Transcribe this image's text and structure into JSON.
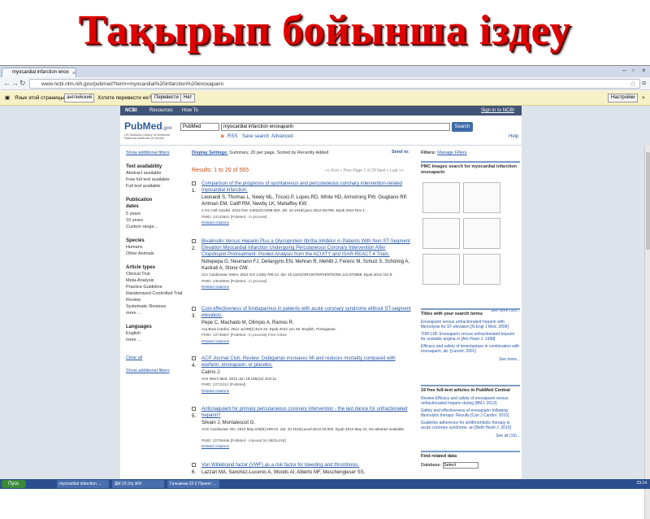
{
  "slide_title": "Тақырып бойынша іздеу",
  "browser": {
    "tab_title": "myocardial infarction enox",
    "url": "www.ncbi.nlm.nih.gov/pubmed?term=myocardial%20infarction%20enoxaparin"
  },
  "translate_bar": {
    "language_label": "Язык этой страницы:",
    "language_value": "английский",
    "question": "Хотите перевести ее?",
    "translate_button": "Перевести",
    "no_button": "Нет",
    "settings_button": "Настройки"
  },
  "ncbi": {
    "logo": "NCBI",
    "resources": "Resources",
    "how_to": "How To",
    "sign_in": "Sign in to NCBI"
  },
  "pubmed": {
    "logo": "PubMed",
    "logo_gov": ".gov",
    "logo_sub": "US National Library of Medicine National Institutes of Health",
    "db_value": "PubMed",
    "query": "myocardial infarction enoxaparin",
    "search_button": "Search",
    "rss": "RSS",
    "save_search": "Save search",
    "advanced": "Advanced",
    "help": "Help"
  },
  "filters": {
    "show_additional": "Show additional filters",
    "text_availability": "Text availability",
    "text_items": [
      "Abstract available",
      "Free full text available",
      "Full text available"
    ],
    "pub_dates": "Publication dates",
    "date_items": [
      "5 years",
      "10 years",
      "Custom range..."
    ],
    "species": "Species",
    "species_items": [
      "Humans",
      "Other Animals"
    ],
    "article_types": "Article types",
    "article_items": [
      "Clinical Trial",
      "Meta-Analysis",
      "Practice Guideline",
      "Randomized Controlled Trial",
      "Review",
      "Systematic Reviews",
      "more ..."
    ],
    "languages": "Languages",
    "language_items": [
      "English",
      "more ..."
    ],
    "clear_all": "Clear all",
    "show_additional_2": "Show additional filters"
  },
  "results": {
    "display_settings": "Display Settings:",
    "display_desc": "Summary, 20 per page, Sorted by Recently Added",
    "send_to": "Send to:",
    "count": "Results: 1 to 20 of 565",
    "pager": "<< First  < Prev  Page 1 of 29  Next >  Last >>"
  },
  "citations": [
    {
      "num": "1.",
      "title": "Comparison of the prognosis of spontaneous and percutaneous coronary intervention-related myocardial infarction.",
      "authors": "Leonardi S, Thomas L, Neely ML, Tricoci P, Lopes RD, White HD, Armstrong PW, Giugliano RP, Antman EM, Califf RM, Newby LK, Mahaffey KW.",
      "journal": "J Am Coll Cardiol. 2012 Dec 4;60(22):2296-304. doi: 10.1016/j.jacc.2012.09.005. Epub 2012 Nov 1.",
      "pmid": "PMID: 23122801 [PubMed - in process]",
      "related": "Related citations"
    },
    {
      "num": "2.",
      "title": "Bivalirudin Versus Heparin Plus a Glycoprotein IIb/IIIa Inhibitor in Patients With Non-ST-Segment Elevation Myocardial Infarction Undergoing Percutaneous Coronary Intervention After Clopidogrel Pretreatment: Pooled Analysis from the ACUITY and ISAR-REACT 4 Trials.",
      "authors": "Ndrepepa G, Neumann FJ, Deliargyris EN, Mehran R, Mehilli J, Ferenc M, Schulz S, Schömig A, Kastrati A, Stone GW.",
      "journal": "Circ Cardiovasc Interv. 2012 Oct 1;5(5):705-12. doi: 10.1161/CIRCINTERVENTIONS.112.972869. Epub 2012 Oct 9.",
      "pmid": "PMID: 23048052 [PubMed - in process]",
      "related": "Related citations"
    },
    {
      "num": "3.",
      "title": "Cost-effectiveness of fondaparinux in patients with acute coronary syndrome without ST-segment elevation.",
      "authors": "Pepe C, Machado M, Olimpio A, Ramos R.",
      "journal": "Arq Bras Cardiol. 2012 Jul;99(1):613-22. Epub 2012 Jun 26. English, Portuguese.",
      "pmid": "PMID: 22735867 [PubMed - in process]   Free Article",
      "related": "Related citations"
    },
    {
      "num": "4.",
      "title": "ACP Journal Club. Review: Dabigatran increases MI and reduces mortality compared with warfarin, enoxaparin, or placebo.",
      "authors": "Cairns J.",
      "journal": "Ann Intern Med. 2012 Jun 19;156(12):JC6-11.",
      "pmid": "PMID: 22711112 [PubMed]",
      "related": "Related citations"
    },
    {
      "num": "5.",
      "title": "Anticoagulant for primary percutaneous coronary intervention - the last dance for unfractionated heparin?",
      "authors": "Silvain J, Montalescot G.",
      "journal": "Arch Cardiovasc Dis. 2012 May;105(5):259-61. doi: 10.1016/j.acvd.2012.03.002. Epub 2012 May 22. No abstract available.",
      "pmid": "PMID: 22709466 [PubMed - indexed for MEDLINE]",
      "related": "Related citations"
    },
    {
      "num": "6.",
      "title": "Von Willebrand factor (VWF) as a risk factor for bleeding and thrombosis.",
      "authors": "Lazzari MA, Sanchez-Luceros A, Woods AI, Alberto MF, Meschengieser SS.",
      "journal": "",
      "pmid": "",
      "related": ""
    }
  ],
  "right": {
    "filters_label": "Filters:",
    "manage_filters": "Manage Filters",
    "pmc_title": "PMC Images search for myocardial infarction enoxaparin",
    "pmc_more": "See more (10)...",
    "titles_head": "Titles with your search terms",
    "title_items": [
      "Enoxaparin versus unfractionated heparin with fibrinolysis for ST-elevation [N Engl J Med. 2006]",
      "TIMI 11B. Enoxaparin versus unfractionated heparin for unstable angina or [Am Heart J. 1998]",
      "Efficacy and safety of tenecteplase in combination with enoxaparin, ab- [Lancet. 2001]"
    ],
    "titles_more": "See more...",
    "pmc_head": "19 free full-text articles in PubMed Central",
    "pmc_items": [
      "Review Efficacy and safety of enoxaparin versus unfractionated heparin during [BMJ. 2012]",
      "Safety and effectiveness of enoxaparin following fibrinolytic therapy: Results [Can J Cardiol. 2010]",
      "Guideline adherence for antithrombotic therapy in acute coronary syndrome: an [Neth Heart J. 2010]"
    ],
    "pmc_all": "See all (19)...",
    "find_related": "Find related data",
    "database_label": "Database:",
    "database_value": "Select"
  },
  "taskbar": {
    "start": "Пуск",
    "tasks": [
      "myocardial infarction ...",
      "ДМ 22-2rp ЖЯ",
      "Гальмеак-22-2 Проект ..."
    ],
    "clock": "23:14"
  },
  "colors": {
    "title_red": "#e00000",
    "ncbi_bar": "#415475",
    "link_blue": "#2656a5",
    "result_orange": "#c84b0f"
  }
}
